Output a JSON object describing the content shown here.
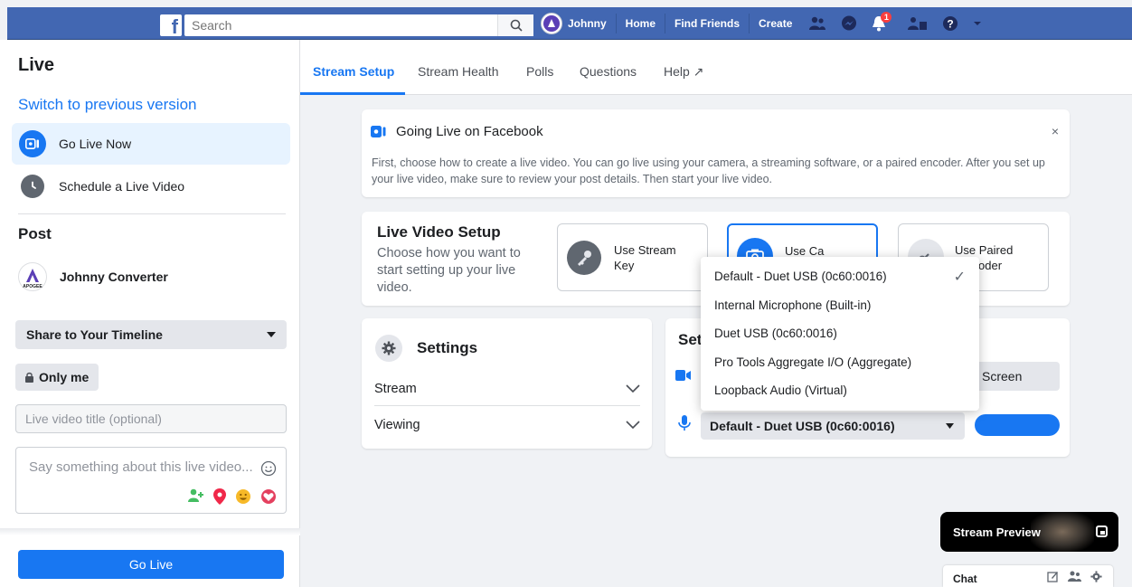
{
  "colors": {
    "brand": "#4267b2",
    "accent": "#1877f2",
    "notification": "#fa3e3e"
  },
  "topbar": {
    "logo": "f",
    "search_placeholder": "Search",
    "user_name": "Johnny",
    "links": [
      "Home",
      "Find Friends",
      "Create"
    ],
    "notification_count": "1",
    "icons": [
      "friend-requests-icon",
      "messenger-icon",
      "notifications-icon",
      "groups-icon",
      "help-icon",
      "account-menu-icon"
    ]
  },
  "sidebar": {
    "title": "Live",
    "switch_link": "Switch to previous version",
    "items": [
      {
        "label": "Go Live Now",
        "icon": "live-camera-icon",
        "active": true
      },
      {
        "label": "Schedule a Live Video",
        "icon": "clock-icon",
        "active": false
      }
    ],
    "post_heading": "Post",
    "user_name": "Johnny Converter",
    "avatar_caption": "APOGEE",
    "share_select": "Share to Your Timeline",
    "privacy_button": "Only me",
    "title_placeholder": "Live video title (optional)",
    "description_placeholder": "Say something about this live video...",
    "go_live_button": "Go Live"
  },
  "tabs": [
    {
      "label": "Stream Setup",
      "active": true
    },
    {
      "label": "Stream Health",
      "active": false
    },
    {
      "label": "Polls",
      "active": false
    },
    {
      "label": "Questions",
      "active": false
    },
    {
      "label": "Help ↗",
      "active": false
    }
  ],
  "info_card": {
    "title": "Going Live on Facebook",
    "body": "First, choose how to create a live video. You can go live using your camera, a streaming software, or a paired encoder. After you set up your live video, make sure to review your post details. Then start your live video.",
    "close": "×"
  },
  "live_setup": {
    "title": "Live Video Setup",
    "description": "Choose how you want to start setting up your live video.",
    "options": [
      {
        "label": "Use Stream Key",
        "icon": "key-icon",
        "selected": false
      },
      {
        "label": "Use Camera",
        "visible_label": "Use Ca",
        "icon": "camera-icon",
        "selected": true
      },
      {
        "label": "Use Paired Encoder",
        "visible_label": "Use Paired\nEncoder",
        "visible_line1": "Use Paired",
        "visible_line2": "oder",
        "icon": "link-icon",
        "selected": false
      }
    ]
  },
  "settings": {
    "title": "Settings",
    "rows": [
      "Stream",
      "Viewing"
    ]
  },
  "setup_panel": {
    "title_visible": "Set",
    "screen_button": "Screen",
    "mic_selected": "Default - Duet USB (0c60:0016)"
  },
  "mic_dropdown": {
    "options": [
      {
        "label": "Default - Duet USB (0c60:0016)",
        "checked": true
      },
      {
        "label": "Internal Microphone (Built-in)",
        "checked": false
      },
      {
        "label": "Duet USB (0c60:0016)",
        "checked": false
      },
      {
        "label": "Pro Tools Aggregate I/O (Aggregate)",
        "checked": false
      },
      {
        "label": "Loopback Audio (Virtual)",
        "checked": false
      }
    ],
    "check_mark": "✓"
  },
  "preview": {
    "label": "Stream Preview"
  },
  "chat": {
    "label": "Chat"
  }
}
